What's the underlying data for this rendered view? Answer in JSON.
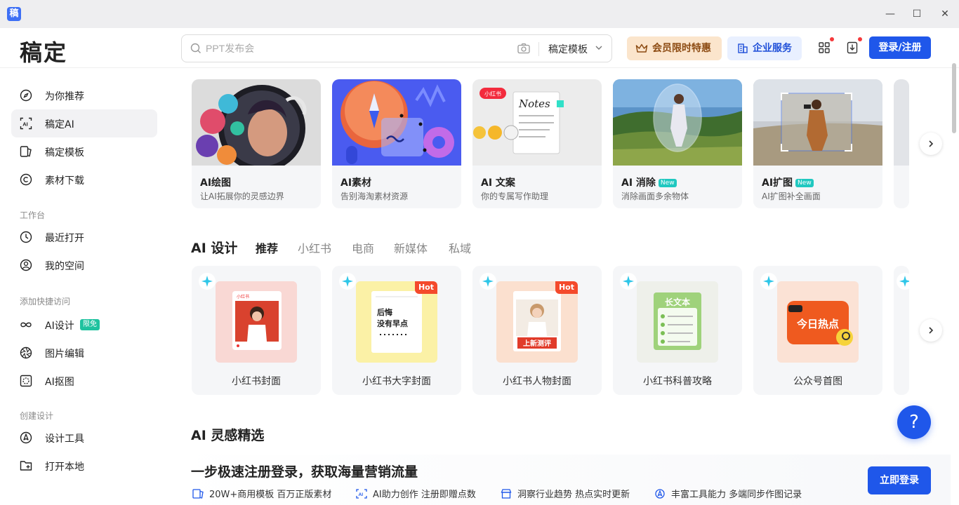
{
  "app": {
    "icon_char": "稿",
    "logo": "稿定"
  },
  "search": {
    "placeholder": "PPT发布会",
    "scope": "稿定模板"
  },
  "header": {
    "vip": "会员限时特惠",
    "enterprise": "企业服务",
    "login": "登录/注册"
  },
  "sidebar": {
    "main": [
      {
        "label": "为你推荐",
        "icon": "compass-icon"
      },
      {
        "label": "稿定AI",
        "icon": "ai-scan-icon"
      },
      {
        "label": "稿定模板",
        "icon": "template-icon"
      },
      {
        "label": "素材下载",
        "icon": "copyright-icon"
      }
    ],
    "workspace_title": "工作台",
    "workspace": [
      {
        "label": "最近打开",
        "icon": "clock-icon"
      },
      {
        "label": "我的空间",
        "icon": "user-icon"
      }
    ],
    "quick_title": "添加快捷访问",
    "quick": [
      {
        "label": "AI设计",
        "badge": "限免",
        "icon": "infinity-icon"
      },
      {
        "label": "图片编辑",
        "icon": "aperture-icon"
      },
      {
        "label": "AI抠图",
        "icon": "cutout-icon"
      }
    ],
    "create_title": "创建设计",
    "create": [
      {
        "label": "设计工具",
        "icon": "pen-tool-icon"
      },
      {
        "label": "打开本地",
        "icon": "folder-plus-icon"
      }
    ]
  },
  "features": [
    {
      "title": "AI绘图",
      "sub": "让AI拓展你的灵感边界",
      "new": ""
    },
    {
      "title": "AI素材",
      "sub": "告别海淘素材资源",
      "new": ""
    },
    {
      "title": "AI 文案",
      "sub": "你的专属写作助理",
      "new": ""
    },
    {
      "title": "AI 消除",
      "sub": "消除画面多余物体",
      "new": "New"
    },
    {
      "title": "AI扩图",
      "sub": "AI扩图补全画面",
      "new": "New"
    }
  ],
  "feature_thumbs": {
    "xhs_tag": "小红书",
    "notes_text": "Notes"
  },
  "ai_design": {
    "title": "AI 设计",
    "tabs": [
      "推荐",
      "小红书",
      "电商",
      "新媒体",
      "私域"
    ],
    "cards": [
      {
        "label": "小红书封面",
        "hot": "",
        "inner_text": "小红书"
      },
      {
        "label": "小红书大字封面",
        "hot": "Hot",
        "inner_text": "后悔\n没有早点"
      },
      {
        "label": "小红书人物封面",
        "hot": "Hot",
        "inner_text": "上新测评"
      },
      {
        "label": "小红书科普攻略",
        "hot": "",
        "inner_text": "长文本"
      },
      {
        "label": "公众号首图",
        "hot": "",
        "inner_text": "今日热点"
      }
    ]
  },
  "inspiration": {
    "title": "AI 灵感精选"
  },
  "promo": {
    "title": "一步极速注册登录，获取海量营销流量",
    "features": [
      "20W+商用模板 百万正版素材",
      "AI助力创作 注册即赠点数",
      "洞察行业趋势 热点实时更新",
      "丰富工具能力 多端同步作图记录"
    ],
    "cta": "立即登录"
  },
  "help": {
    "label": "?"
  },
  "window": {
    "minimize": "—",
    "maximize": "☐",
    "close": "✕"
  }
}
